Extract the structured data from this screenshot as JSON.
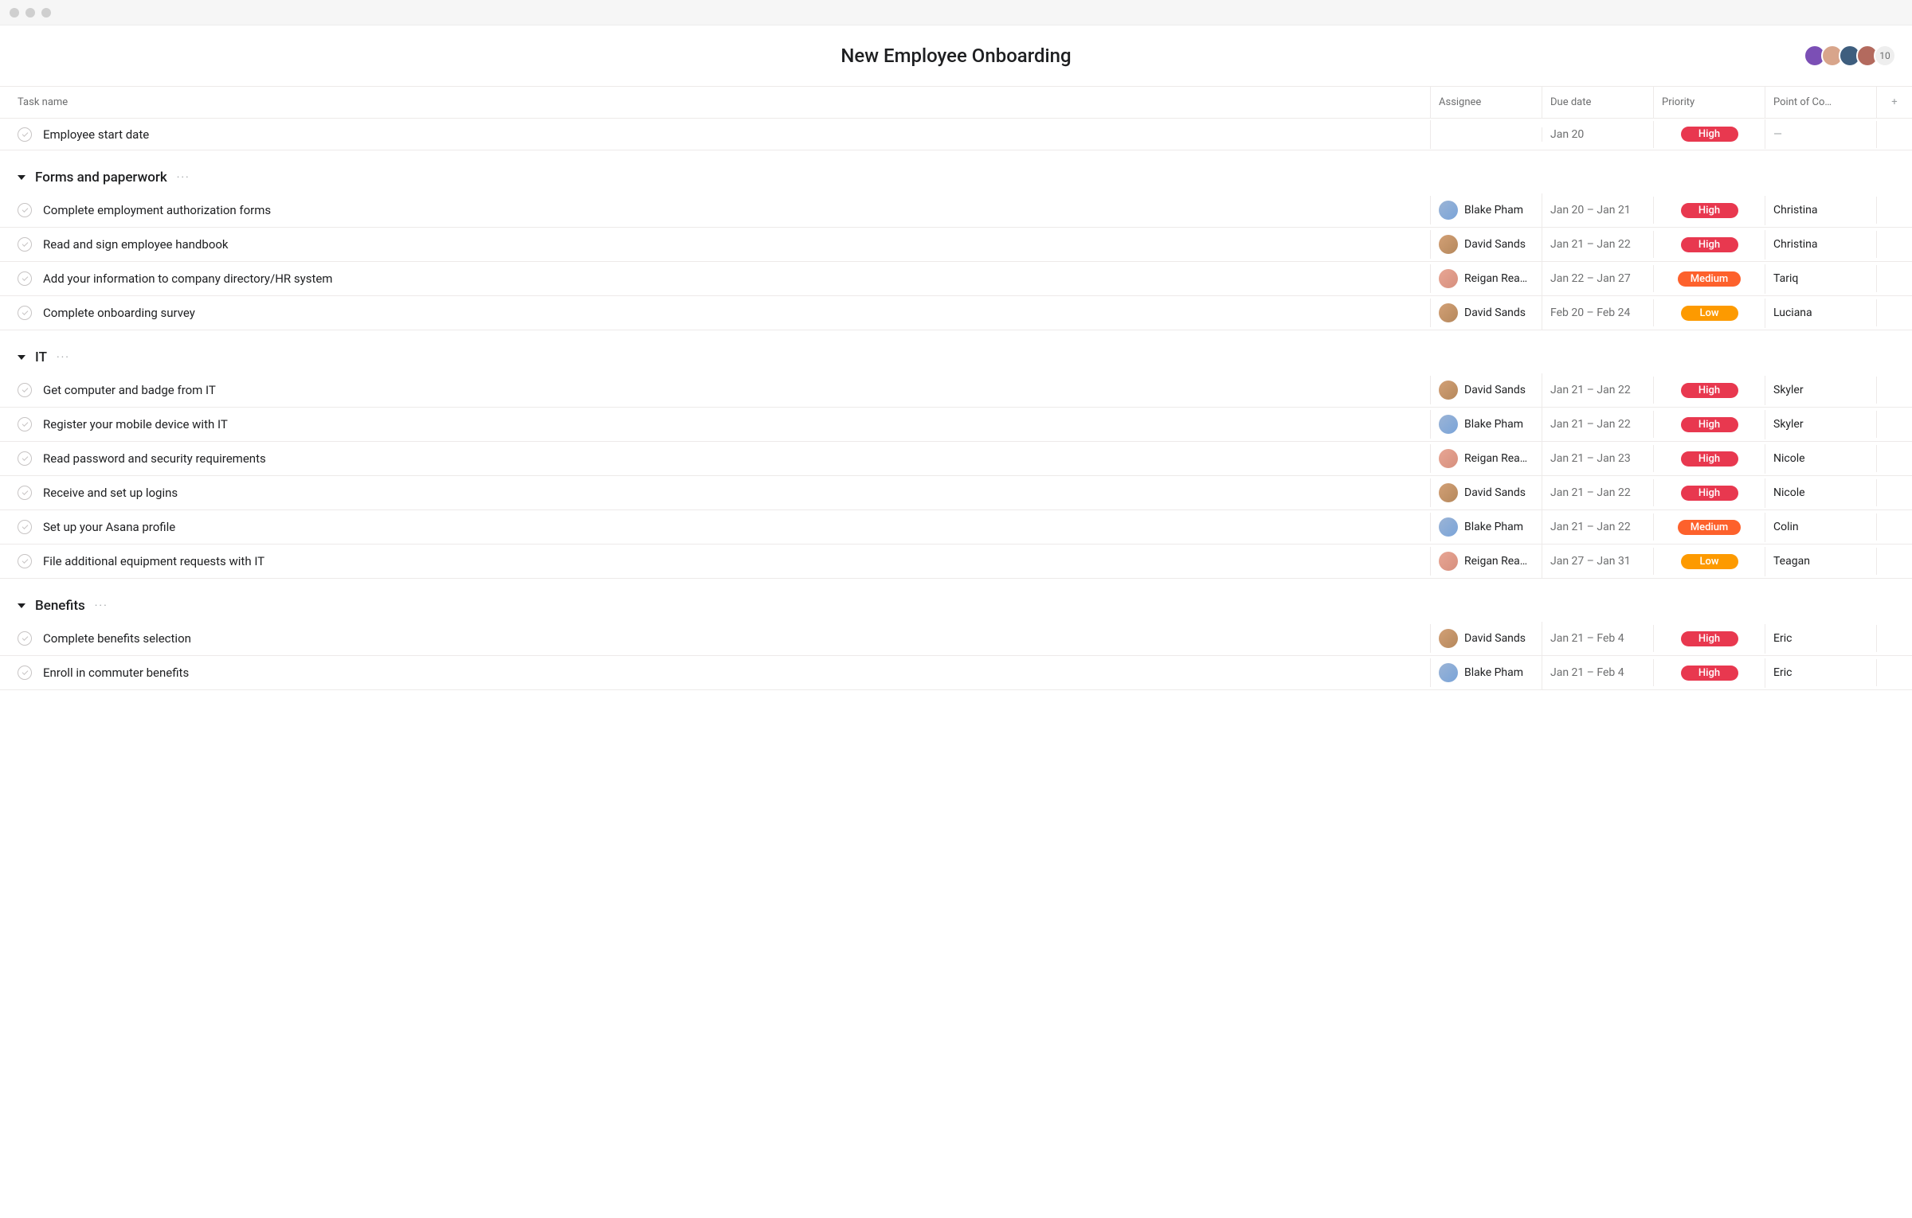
{
  "title": "New Employee Onboarding",
  "collaborator_overflow": "10",
  "columns": {
    "task": "Task name",
    "assignee": "Assignee",
    "due": "Due date",
    "priority": "Priority",
    "poc": "Point of Co…",
    "add": "+"
  },
  "top_task": {
    "name": "Employee start date",
    "assignee": "",
    "due": "Jan 20",
    "priority": "High",
    "poc": "—"
  },
  "sections": [
    {
      "title": "Forms and paperwork",
      "tasks": [
        {
          "name": "Complete employment authorization forms",
          "assignee": "Blake Pham",
          "avatar": "sa-blue",
          "due": "Jan 20 – Jan 21",
          "priority": "High",
          "poc": "Christina"
        },
        {
          "name": "Read and sign employee handbook",
          "assignee": "David Sands",
          "avatar": "sa-tan",
          "due": "Jan 21 – Jan 22",
          "priority": "High",
          "poc": "Christina"
        },
        {
          "name": "Add your information to company directory/HR system",
          "assignee": "Reigan Rea…",
          "avatar": "sa-pink",
          "due": "Jan 22 – Jan 27",
          "priority": "Medium",
          "poc": "Tariq"
        },
        {
          "name": "Complete onboarding survey",
          "assignee": "David Sands",
          "avatar": "sa-tan",
          "due": "Feb 20 – Feb 24",
          "priority": "Low",
          "poc": "Luciana"
        }
      ]
    },
    {
      "title": "IT",
      "tasks": [
        {
          "name": "Get computer and badge from IT",
          "assignee": "David Sands",
          "avatar": "sa-tan",
          "due": "Jan 21 – Jan 22",
          "priority": "High",
          "poc": "Skyler"
        },
        {
          "name": "Register your mobile device with IT",
          "assignee": "Blake Pham",
          "avatar": "sa-blue",
          "due": "Jan 21 – Jan 22",
          "priority": "High",
          "poc": "Skyler"
        },
        {
          "name": "Read password and security requirements",
          "assignee": "Reigan Rea…",
          "avatar": "sa-pink",
          "due": "Jan 21 – Jan 23",
          "priority": "High",
          "poc": "Nicole"
        },
        {
          "name": "Receive and set up logins",
          "assignee": "David Sands",
          "avatar": "sa-tan",
          "due": "Jan 21 – Jan 22",
          "priority": "High",
          "poc": "Nicole"
        },
        {
          "name": "Set up your Asana profile",
          "assignee": "Blake Pham",
          "avatar": "sa-blue",
          "due": "Jan 21 – Jan 22",
          "priority": "Medium",
          "poc": "Colin"
        },
        {
          "name": "File additional equipment requests with IT",
          "assignee": "Reigan Rea…",
          "avatar": "sa-pink",
          "due": "Jan 27 – Jan 31",
          "priority": "Low",
          "poc": "Teagan"
        }
      ]
    },
    {
      "title": "Benefits",
      "tasks": [
        {
          "name": "Complete benefits selection",
          "assignee": "David Sands",
          "avatar": "sa-tan",
          "due": "Jan 21 – Feb 4",
          "priority": "High",
          "poc": "Eric"
        },
        {
          "name": "Enroll in commuter benefits",
          "assignee": "Blake Pham",
          "avatar": "sa-blue",
          "due": "Jan 21 – Feb 4",
          "priority": "High",
          "poc": "Eric"
        }
      ]
    }
  ]
}
